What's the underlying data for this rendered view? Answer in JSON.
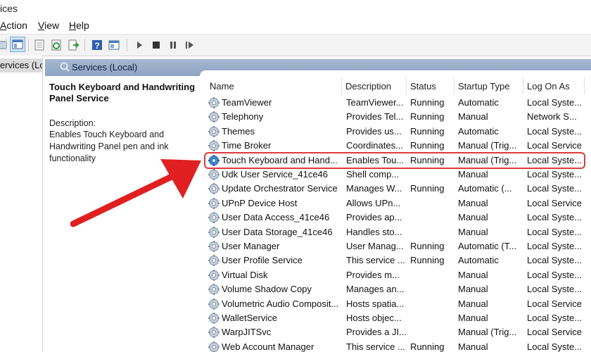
{
  "window": {
    "title": "ices"
  },
  "menu": {
    "items": [
      {
        "label": "Action",
        "underline_char": "A"
      },
      {
        "label": "View",
        "underline_char": "V"
      },
      {
        "label": "Help",
        "underline_char": "H"
      }
    ]
  },
  "toolbar": {
    "icons": [
      "back-icon",
      "properties-pane-icon",
      "export-list-icon",
      "refresh-icon",
      "export-icon",
      "help-icon",
      "view-icon",
      "play-icon",
      "stop-icon",
      "pause-icon",
      "resume-icon"
    ]
  },
  "tree": {
    "selected_label": "ervices (Loca"
  },
  "main": {
    "header_title": "Services (Local)"
  },
  "details": {
    "service_title": "Touch Keyboard and Handwriting Panel Service",
    "description_label": "Description:",
    "description_text": "Enables Touch Keyboard and Handwriting Panel pen and ink functionality"
  },
  "table": {
    "columns": [
      "Name",
      "Description",
      "Status",
      "Startup Type",
      "Log On As"
    ],
    "rows": [
      [
        "TeamViewer",
        "TeamViewer...",
        "Running",
        "Automatic",
        "Local Syste..."
      ],
      [
        "Telephony",
        "Provides Tel...",
        "Running",
        "Manual",
        "Network S..."
      ],
      [
        "Themes",
        "Provides us...",
        "Running",
        "Automatic",
        "Local Syste..."
      ],
      [
        "Time Broker",
        "Coordinates...",
        "Running",
        "Manual (Trig...",
        "Local Service"
      ],
      [
        "Touch Keyboard and Hand...",
        "Enables Tou...",
        "Running",
        "Manual (Trig...",
        "Local Syste..."
      ],
      [
        "Udk User Service_41ce46",
        "Shell comp...",
        "",
        "Manual",
        "Local Syste..."
      ],
      [
        "Update Orchestrator Service",
        "Manages W...",
        "Running",
        "Automatic (...",
        "Local Syste..."
      ],
      [
        "UPnP Device Host",
        "Allows UPn...",
        "",
        "Manual",
        "Local Service"
      ],
      [
        "User Data Access_41ce46",
        "Provides ap...",
        "",
        "Manual",
        "Local Syste..."
      ],
      [
        "User Data Storage_41ce46",
        "Handles sto...",
        "",
        "Manual",
        "Local Syste..."
      ],
      [
        "User Manager",
        "User Manag...",
        "Running",
        "Automatic (T...",
        "Local Syste..."
      ],
      [
        "User Profile Service",
        "This service ...",
        "Running",
        "Automatic",
        "Local Syste..."
      ],
      [
        "Virtual Disk",
        "Provides m...",
        "",
        "Manual",
        "Local Syste..."
      ],
      [
        "Volume Shadow Copy",
        "Manages an...",
        "",
        "Manual",
        "Local Syste..."
      ],
      [
        "Volumetric Audio Composit...",
        "Hosts spatia...",
        "",
        "Manual",
        "Local Service"
      ],
      [
        "WalletService",
        "Hosts objec...",
        "",
        "Manual",
        "Local Syste..."
      ],
      [
        "WarpJITSvc",
        "Provides a JI...",
        "",
        "Manual (Trig...",
        "Local Service"
      ],
      [
        "Web Account Manager",
        "This service ...",
        "Running",
        "Manual",
        "Local Syste..."
      ]
    ]
  },
  "colors": {
    "header_gradient_top": "#a6b8d0",
    "highlight": "#e03a3a",
    "arrow": "#e02020"
  }
}
